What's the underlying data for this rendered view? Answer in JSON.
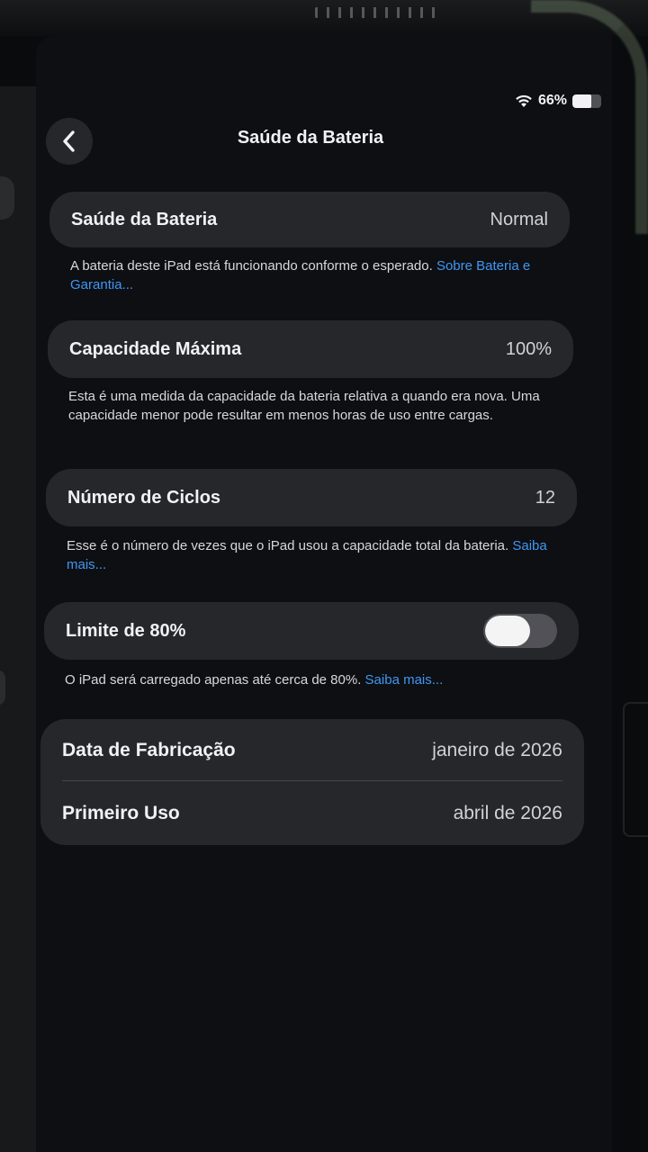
{
  "status_bar": {
    "battery_percent": "66%",
    "battery_level": 0.66
  },
  "nav": {
    "title": "Saúde da Bateria"
  },
  "battery_health": {
    "label": "Saúde da Bateria",
    "value": "Normal",
    "note": "A bateria deste iPad está funcionando conforme o esperado. ",
    "note_link": "Sobre Bateria e Garantia..."
  },
  "max_capacity": {
    "label": "Capacidade Máxima",
    "value": "100%",
    "note": "Esta é uma medida da capacidade da bateria relativa a quando era nova. Uma capacidade menor pode resultar em menos horas de uso entre cargas."
  },
  "cycle_count": {
    "label": "Número de Ciclos",
    "value": "12",
    "note": "Esse é o número de vezes que o iPad usou a capacidade total da bateria. ",
    "note_link": "Saiba mais..."
  },
  "limit_80": {
    "label": "Limite de 80%",
    "toggle_on": false,
    "note": "O iPad será carregado apenas até cerca de 80%. ",
    "note_link": "Saiba mais..."
  },
  "dates": {
    "manufacture_label": "Data de Fabricação",
    "manufacture_value": "janeiro de 2026",
    "first_use_label": "Primeiro Uso",
    "first_use_value": "abril de 2026"
  }
}
